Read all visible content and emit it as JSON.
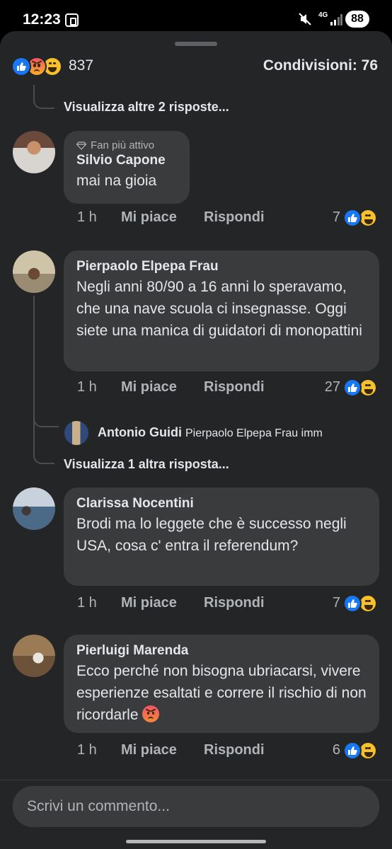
{
  "status_bar": {
    "time": "12:23",
    "network": "4G",
    "battery": "88"
  },
  "summary": {
    "reaction_count": "837",
    "shares_label": "Condivisioni: 76",
    "reactions": [
      "like-icon",
      "angry-icon",
      "haha-icon"
    ]
  },
  "thread": {
    "more_replies_top": "Visualizza altre 2 risposte..."
  },
  "comments": [
    {
      "badge": "Fan più attivo",
      "author": "Silvio Capone",
      "text": "mai na gioia",
      "time": "1 h",
      "like": "Mi piace",
      "reply": "Rispondi",
      "count": "7"
    },
    {
      "author": "Pierpaolo Elpepa Frau",
      "text": "Negli anni 80/90 a 16 anni lo speravamo, che una nave scuola ci insegnasse. Oggi siete una manica di guidatori di monopattini",
      "time": "1 h",
      "like": "Mi piace",
      "reply": "Rispondi",
      "count": "27",
      "reply_preview": {
        "author": "Antonio Guidi",
        "text": "Pierpaolo Elpepa Frau  imm"
      },
      "more_replies": "Visualizza 1 altra risposta..."
    },
    {
      "author": "Clarissa Nocentini",
      "text": "Brodi ma lo leggete che è successo negli USA, cosa c' entra il referendum?",
      "time": "1 h",
      "like": "Mi piace",
      "reply": "Rispondi",
      "count": "7"
    },
    {
      "author": "Pierluigi Marenda",
      "text": "Ecco perché non bisogna ubriacarsi, vivere esperienze esaltati e correre il rischio di non ricordarle",
      "time": "1 h",
      "like": "Mi piace",
      "reply": "Rispondi",
      "count": "6"
    }
  ],
  "composer": {
    "placeholder": "Scrivi un commento..."
  }
}
